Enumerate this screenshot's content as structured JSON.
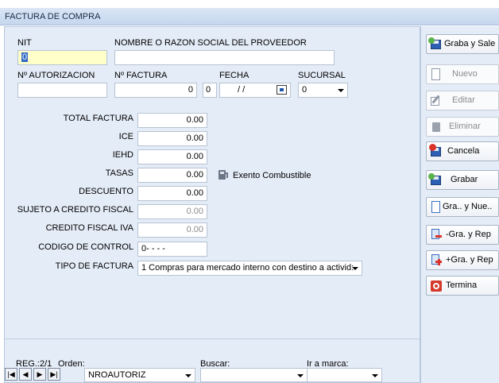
{
  "window": {
    "title": "FACTURA DE COMPRA"
  },
  "header": {
    "nit_label": "NIT",
    "nit_value": "0",
    "razon_label": "NOMBRE O RAZON SOCIAL DEL PROVEEDOR",
    "razon_value": "",
    "autorizacion_label": "Nº AUTORIZACION",
    "autorizacion_value": "",
    "factura_label": "Nº FACTURA",
    "factura_value": "0",
    "fecha_label": "FECHA",
    "fecha_small": "0",
    "fecha_value": "/ /",
    "sucursal_label": "SUCURSAL",
    "sucursal_value": "0"
  },
  "amounts": [
    {
      "label": "TOTAL FACTURA",
      "value": "0.00",
      "enabled": true
    },
    {
      "label": "ICE",
      "value": "0.00",
      "enabled": true
    },
    {
      "label": "IEHD",
      "value": "0.00",
      "enabled": true
    },
    {
      "label": "TASAS",
      "value": "0.00",
      "enabled": true
    },
    {
      "label": "DESCUENTO",
      "value": "0.00",
      "enabled": true
    },
    {
      "label": "SUJETO A CREDITO FISCAL",
      "value": "0.00",
      "enabled": false
    },
    {
      "label": "CREDITO FISCAL IVA",
      "value": "0.00",
      "enabled": false
    }
  ],
  "exento": {
    "label": "Exento Combustible"
  },
  "codigo": {
    "label": "CODIGO DE CONTROL",
    "value": "0- - - -"
  },
  "tipo": {
    "label": "TIPO DE FACTURA",
    "value": "1 Compras para mercado interno con destino a activid:"
  },
  "footer": {
    "reg_label": "REG.:2/1",
    "orden_label": "Orden:",
    "orden_value": "NROAUTORIZ",
    "buscar_label": "Buscar:",
    "buscar_value": "",
    "marca_label": "Ir a marca:",
    "marca_value": ""
  },
  "toolbar": {
    "graba_sale": "Graba y Sale",
    "nuevo": "Nuevo",
    "editar": "Editar",
    "eliminar": "Eliminar",
    "cancela": "Cancela",
    "grabar": "Grabar",
    "gra_nue": "Gra.. y Nue..",
    "gra_rep_minus": "-Gra. y Rep",
    "gra_rep_plus": "+Gra. y Rep",
    "termina": "Termina"
  },
  "colors": {
    "panel": "#e4ecf7",
    "title_bar": "#c6d6ee",
    "input_yellow": "#ffffc9",
    "selected": "#3169c6"
  }
}
